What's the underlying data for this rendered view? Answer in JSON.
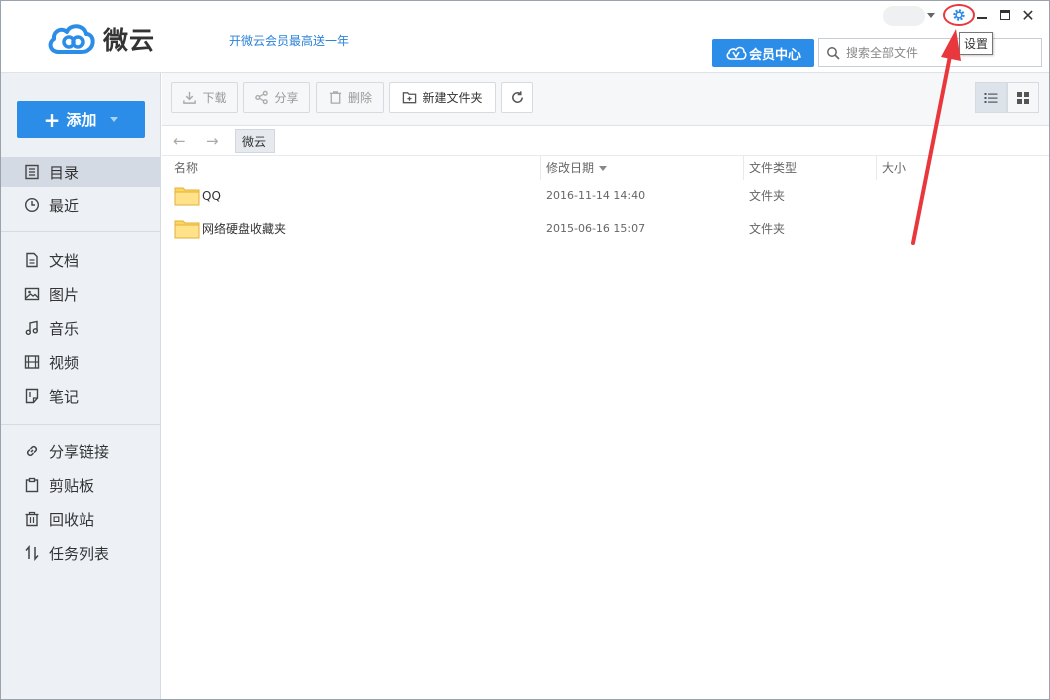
{
  "app": {
    "name": "微云",
    "promo": "开微云会员最高送一年"
  },
  "header": {
    "vip_label": "会员中心",
    "search_placeholder": "搜索全部文件",
    "settings_tooltip": "设置"
  },
  "sidebar": {
    "add_label": "添加",
    "groups": [
      {
        "items": [
          {
            "label": "目录",
            "icon": "list-icon",
            "active": true
          },
          {
            "label": "最近",
            "icon": "clock-icon"
          }
        ]
      },
      {
        "items": [
          {
            "label": "文档",
            "icon": "document-icon"
          },
          {
            "label": "图片",
            "icon": "image-icon"
          },
          {
            "label": "音乐",
            "icon": "music-icon"
          },
          {
            "label": "视频",
            "icon": "video-icon"
          },
          {
            "label": "笔记",
            "icon": "note-icon"
          }
        ]
      },
      {
        "items": [
          {
            "label": "分享链接",
            "icon": "link-icon"
          },
          {
            "label": "剪贴板",
            "icon": "clipboard-icon"
          },
          {
            "label": "回收站",
            "icon": "trash-icon"
          },
          {
            "label": "任务列表",
            "icon": "transfer-icon"
          }
        ]
      }
    ]
  },
  "toolbar": {
    "download": "下载",
    "share": "分享",
    "delete": "删除",
    "new_folder": "新建文件夹"
  },
  "breadcrumb": {
    "current": "微云"
  },
  "table": {
    "headers": {
      "name": "名称",
      "modified": "修改日期",
      "type": "文件类型",
      "size": "大小"
    },
    "rows": [
      {
        "name": "QQ",
        "modified": "2016-11-14 14:40",
        "type": "文件夹",
        "size": ""
      },
      {
        "name": "网络硬盘收藏夹",
        "modified": "2015-06-16 15:07",
        "type": "文件夹",
        "size": ""
      }
    ]
  },
  "colors": {
    "accent": "#2b8de8",
    "annotation": "#e8383d",
    "folder": "#ffd65c"
  }
}
